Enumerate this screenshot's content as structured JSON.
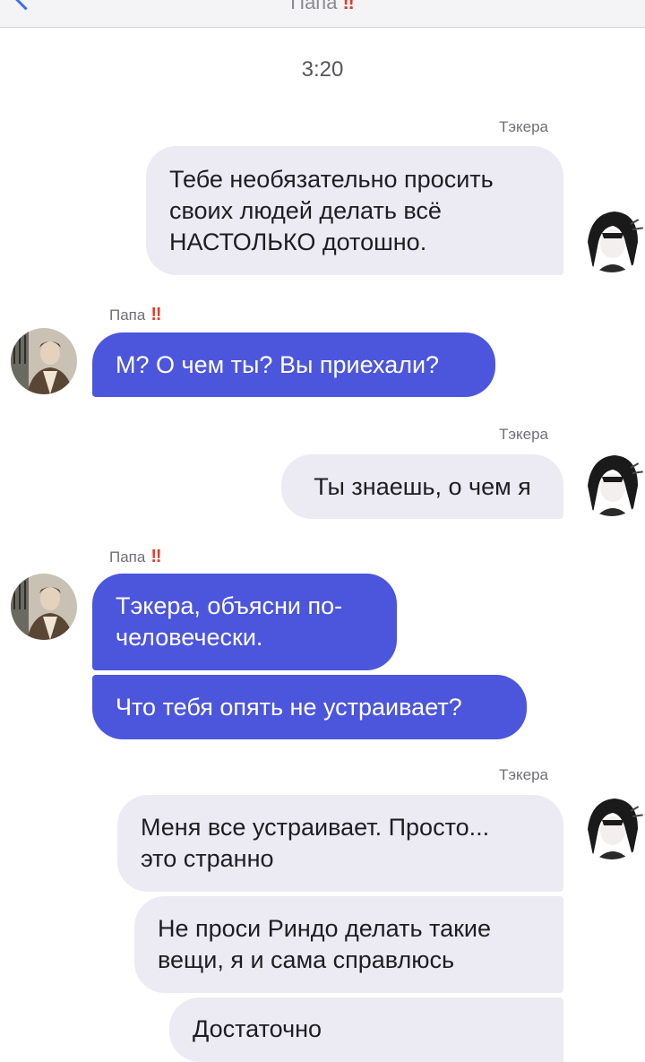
{
  "header": {
    "title": "Папа",
    "flag": "‼"
  },
  "chat": {
    "time": "3:20",
    "self_name": "Тэкера",
    "contact_name": "Папа",
    "contact_flag": "‼",
    "messages": [
      {
        "sender": "Тэкера",
        "lines": [
          "Тебе необязательно просить",
          "своих людей делать всё",
          "НАСТОЛЬКО дотошно."
        ]
      },
      {
        "sender": "Папа",
        "lines": [
          "М? О чем ты? Вы приехали?"
        ]
      },
      {
        "sender": "Тэкера",
        "lines": [
          "Ты знаешь, о чем я"
        ]
      },
      {
        "sender": "Папа",
        "lines": [
          "Тэкера, объясни по-",
          "человечески."
        ]
      },
      {
        "sender": "Папа",
        "lines": [
          "Что тебя опять не устраивает?"
        ]
      },
      {
        "sender": "Тэкера",
        "lines": [
          "Меня все устраивает. Просто...",
          "это странно"
        ]
      },
      {
        "sender": "Тэкера",
        "lines": [
          "Не проси Риндо делать такие",
          "вещи, я и сама справлюсь"
        ]
      },
      {
        "sender": "Тэкера",
        "lines": [
          "Достаточно"
        ]
      }
    ]
  },
  "icons": {
    "back": "chevron-left-icon",
    "self_avatar": "avatar-takera",
    "contact_avatar": "avatar-papa"
  },
  "colors": {
    "outgoing_bubble": "#4c56dc",
    "incoming_bubble": "#eceaf3",
    "flag": "#e23b2a",
    "accent": "#3b6ef0"
  }
}
